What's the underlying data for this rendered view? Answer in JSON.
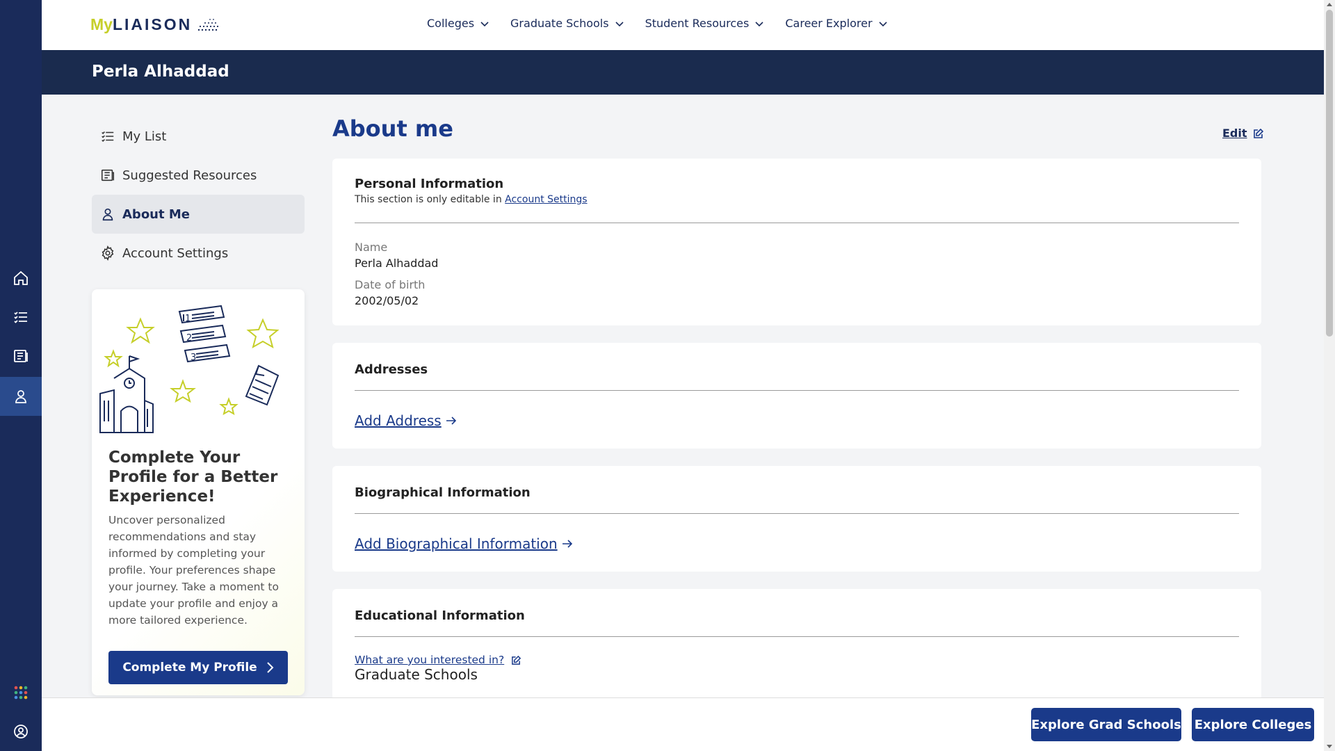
{
  "brand": {
    "logo_my": "My",
    "logo_liaison": "LIAISON"
  },
  "topnav": {
    "items": [
      {
        "label": "Colleges"
      },
      {
        "label": "Graduate Schools"
      },
      {
        "label": "Student Resources"
      },
      {
        "label": "Career Explorer"
      }
    ]
  },
  "banner": {
    "name": "Perla Alhaddad"
  },
  "rail": {
    "icons": [
      "home-icon",
      "list-icon",
      "resources-icon",
      "person-icon",
      "apps-icon",
      "account-icon"
    ],
    "active": "person-icon"
  },
  "sidebar": {
    "items": [
      {
        "label": "My List",
        "icon": "list-icon"
      },
      {
        "label": "Suggested Resources",
        "icon": "resources-icon"
      },
      {
        "label": "About Me",
        "icon": "person-icon",
        "active": true
      },
      {
        "label": "Account Settings",
        "icon": "gear-icon"
      }
    ]
  },
  "promo": {
    "title": "Complete Your Profile for a Better Experience!",
    "text": "Uncover personalized recommendations and stay informed by completing your profile. Your preferences shape your journey. Take a moment to update your profile and enjoy a more tailored experience.",
    "button": "Complete My Profile"
  },
  "main": {
    "title": "About me",
    "edit_label": "Edit",
    "personal": {
      "title": "Personal Information",
      "note": "This section is only editable in",
      "note_link": "Account Settings",
      "name_label": "Name",
      "name_value": "Perla Alhaddad",
      "dob_label": "Date of birth",
      "dob_value": "2002/05/02"
    },
    "addresses": {
      "title": "Addresses",
      "link": "Add Address"
    },
    "bio": {
      "title": "Biographical Information",
      "link": "Add Biographical Information"
    },
    "education": {
      "title": "Educational Information",
      "question": "What are you interested in?",
      "answer": "Graduate Schools"
    }
  },
  "bottombar": {
    "grad_button": "Explore Grad Schools",
    "colleges_button": "Explore Colleges"
  },
  "colors": {
    "navy": "#1a2b5a",
    "accent_blue": "#1a3a8a",
    "lime": "#c6cf2a"
  }
}
